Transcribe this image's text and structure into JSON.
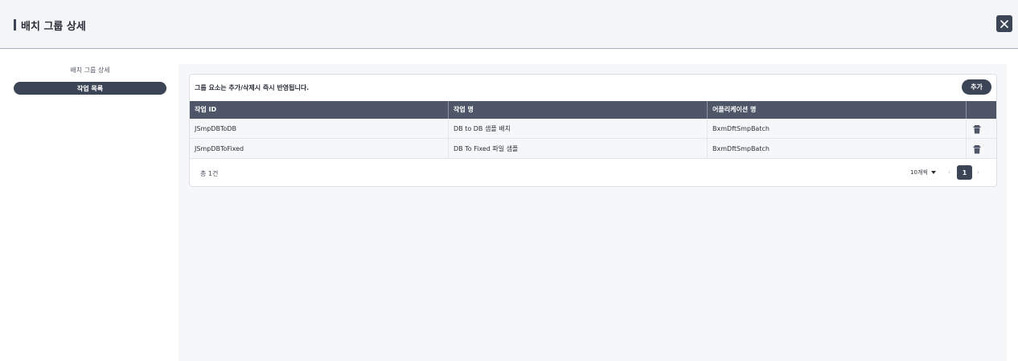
{
  "header": {
    "title": "배치 그룹 상세",
    "close_icon": "close-icon"
  },
  "sidebar": {
    "caption": "배치 그룹 상세",
    "active_item": "작업 목록"
  },
  "main": {
    "note": "그룹 요소는 추가/삭제시 즉시 반영됩니다.",
    "add_label": "추가",
    "columns": [
      "작업 ID",
      "작업 명",
      "어플리케이션 명",
      ""
    ],
    "rows": [
      {
        "id": "JSmpDBToDB",
        "name": "DB to DB 샘플 배치",
        "app": "BxmDftSmpBatch",
        "action_icon": "trash-icon"
      },
      {
        "id": "JSmpDBToFixed",
        "name": "DB To Fixed 파일 샘플",
        "app": "BxmDftSmpBatch",
        "action_icon": "trash-icon"
      }
    ],
    "footer": {
      "total": "총 1건",
      "per_page": "10개씩",
      "prev": "‹",
      "current_page": "1",
      "next": "›"
    }
  },
  "colors": {
    "primary": "#3c4556",
    "header_bg": "#f3f5f8",
    "table_head": "#4e5668"
  }
}
